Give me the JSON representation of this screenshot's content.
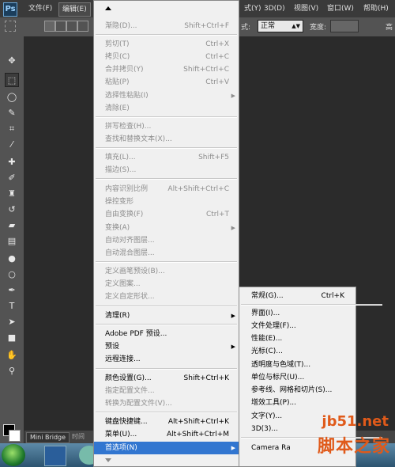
{
  "menubar": {
    "logo": "Ps",
    "file": "文件(F)",
    "edit": "编辑(E)",
    "partial": "式(Y)",
    "three_d": "3D(D)",
    "view": "视图(V)",
    "window": "窗口(W)",
    "help": "帮助(H)"
  },
  "options_bar": {
    "style_label": "式:",
    "style_value": "正常",
    "width_label": "宽度:",
    "height_label": "高"
  },
  "tools": [
    "move-tool",
    "rect-marquee-tool",
    "lasso-tool",
    "quick-select-tool",
    "crop-tool",
    "eyedropper-tool",
    "spot-heal-tool",
    "brush-tool",
    "clone-stamp-tool",
    "history-brush-tool",
    "eraser-tool",
    "gradient-tool",
    "blur-tool",
    "dodge-tool",
    "pen-tool",
    "type-tool",
    "path-select-tool",
    "rectangle-tool",
    "hand-tool",
    "zoom-tool"
  ],
  "bottom_tabs": {
    "mini_bridge": "Mini Bridge",
    "timeline": "时间"
  },
  "edit_menu": {
    "items": [
      {
        "label": "渐隐(D)...",
        "shortcut": "Shift+Ctrl+F",
        "disabled": true
      },
      {
        "label": "剪切(T)",
        "shortcut": "Ctrl+X",
        "disabled": true
      },
      {
        "label": "拷贝(C)",
        "shortcut": "Ctrl+C",
        "disabled": true
      },
      {
        "label": "合并拷贝(Y)",
        "shortcut": "Shift+Ctrl+C",
        "disabled": true
      },
      {
        "label": "粘贴(P)",
        "shortcut": "Ctrl+V",
        "disabled": true
      },
      {
        "label": "选择性粘贴(I)",
        "shortcut": "",
        "disabled": true,
        "submenu": true
      },
      {
        "label": "清除(E)",
        "shortcut": "",
        "disabled": true
      },
      {
        "label": "拼写检查(H)...",
        "shortcut": "",
        "disabled": true
      },
      {
        "label": "查找和替换文本(X)...",
        "shortcut": "",
        "disabled": true
      },
      {
        "label": "填充(L)...",
        "shortcut": "Shift+F5",
        "disabled": true
      },
      {
        "label": "描边(S)...",
        "shortcut": "",
        "disabled": true
      },
      {
        "label": "内容识别比例",
        "shortcut": "Alt+Shift+Ctrl+C",
        "disabled": true
      },
      {
        "label": "操控变形",
        "shortcut": "",
        "disabled": true
      },
      {
        "label": "自由变换(F)",
        "shortcut": "Ctrl+T",
        "disabled": true
      },
      {
        "label": "变换(A)",
        "shortcut": "",
        "disabled": true,
        "submenu": true
      },
      {
        "label": "自动对齐图层...",
        "shortcut": "",
        "disabled": true
      },
      {
        "label": "自动混合图层...",
        "shortcut": "",
        "disabled": true
      },
      {
        "label": "定义画笔预设(B)...",
        "shortcut": "",
        "disabled": true
      },
      {
        "label": "定义图案...",
        "shortcut": "",
        "disabled": true
      },
      {
        "label": "定义自定形状...",
        "shortcut": "",
        "disabled": true
      },
      {
        "label": "清理(R)",
        "shortcut": "",
        "disabled": false,
        "submenu": true
      },
      {
        "label": "Adobe PDF 预设...",
        "shortcut": "",
        "disabled": false
      },
      {
        "label": "预设",
        "shortcut": "",
        "disabled": false,
        "submenu": true
      },
      {
        "label": "远程连接...",
        "shortcut": "",
        "disabled": false
      },
      {
        "label": "颜色设置(G)...",
        "shortcut": "Shift+Ctrl+K",
        "disabled": false
      },
      {
        "label": "指定配置文件...",
        "shortcut": "",
        "disabled": true
      },
      {
        "label": "转换为配置文件(V)...",
        "shortcut": "",
        "disabled": true
      },
      {
        "label": "键盘快捷键...",
        "shortcut": "Alt+Shift+Ctrl+K",
        "disabled": false
      },
      {
        "label": "菜单(U)...",
        "shortcut": "Alt+Shift+Ctrl+M",
        "disabled": false
      },
      {
        "label": "首选项(N)",
        "shortcut": "",
        "disabled": false,
        "submenu": true,
        "highlighted": true
      }
    ]
  },
  "preferences_submenu": {
    "items": [
      {
        "label": "常规(G)...",
        "shortcut": "Ctrl+K"
      },
      {
        "label": "界面(I)...",
        "shortcut": ""
      },
      {
        "label": "文件处理(F)...",
        "shortcut": ""
      },
      {
        "label": "性能(E)...",
        "shortcut": ""
      },
      {
        "label": "光标(C)...",
        "shortcut": ""
      },
      {
        "label": "透明度与色域(T)...",
        "shortcut": ""
      },
      {
        "label": "单位与标尺(U)...",
        "shortcut": ""
      },
      {
        "label": "参考线、网格和切片(S)...",
        "shortcut": ""
      },
      {
        "label": "增效工具(P)...",
        "shortcut": ""
      },
      {
        "label": "文字(Y)...",
        "shortcut": ""
      },
      {
        "label": "3D(3)...",
        "shortcut": ""
      },
      {
        "label": "Camera Ra",
        "shortcut": ""
      }
    ]
  },
  "watermark": {
    "url": "jb51.net",
    "text": "脚本之家"
  }
}
